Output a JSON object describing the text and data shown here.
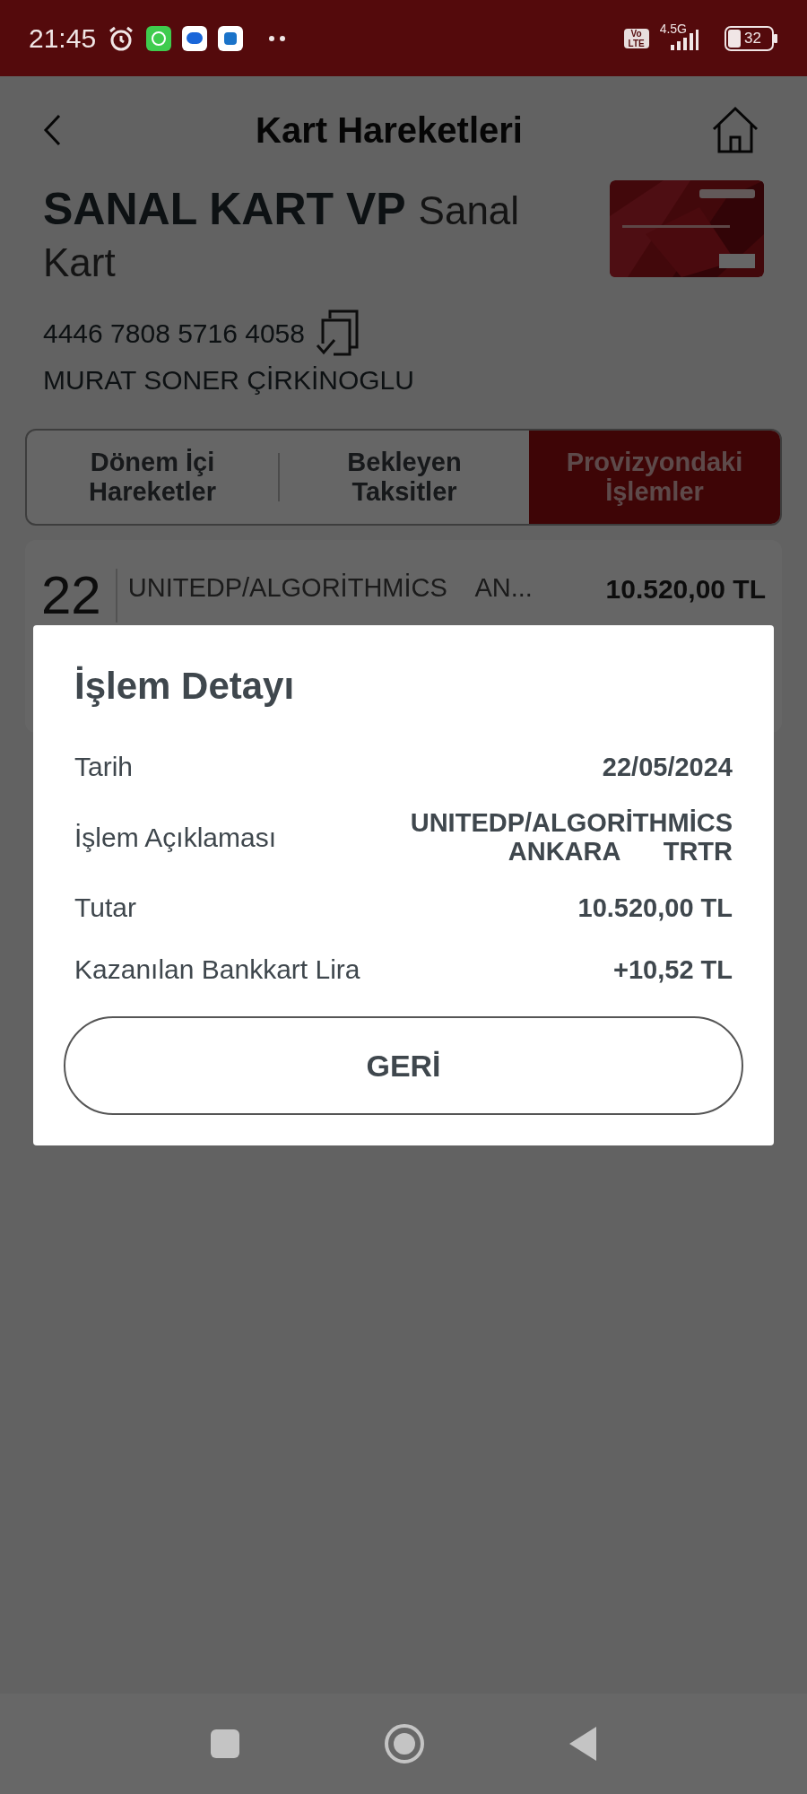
{
  "status_bar": {
    "time": "21:45",
    "volte": "Vo LTE",
    "network": "4.5G",
    "battery": "32"
  },
  "header": {
    "title": "Kart Hareketleri"
  },
  "card": {
    "name": "SANAL KART VP",
    "type": "Sanal Kart",
    "number": "4446 7808 5716 4058",
    "holder": "MURAT SONER ÇİRKİNOGLU"
  },
  "tabs": [
    {
      "label": "Dönem İçi\nHareketler",
      "selected": false
    },
    {
      "label": "Bekleyen\nTaksitler",
      "selected": false
    },
    {
      "label": "Provizyondaki\nİşlemler",
      "selected": true
    }
  ],
  "transactions": [
    {
      "day": "22",
      "description": "UNITEDP/ALGORİTHMİCS    AN...",
      "amount": "10.520,00 TL"
    }
  ],
  "dialog": {
    "title": "İşlem Detayı",
    "rows": [
      {
        "label": "Tarih",
        "value": "22/05/2024"
      },
      {
        "label": "İşlem Açıklaması",
        "value": "UNITEDP/ALGORİTHMİCS\nANKARA      TRTR"
      },
      {
        "label": "Tutar",
        "value": "10.520,00 TL"
      },
      {
        "label": "Kazanılan Bankkart Lira",
        "value": "+10,52 TL"
      }
    ],
    "button": "GERİ"
  }
}
